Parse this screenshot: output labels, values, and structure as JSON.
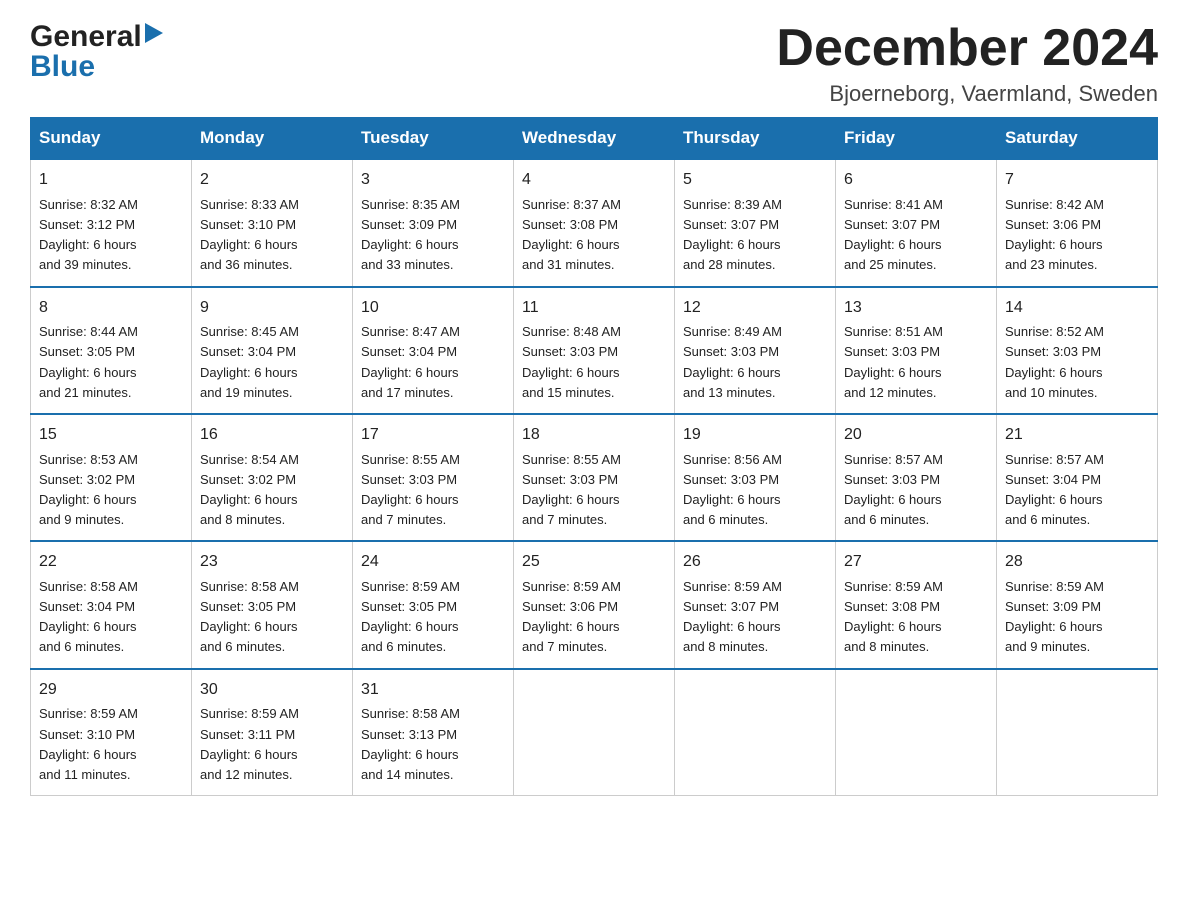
{
  "logo": {
    "general": "General",
    "blue": "Blue",
    "arrow_color": "#1a6fad"
  },
  "header": {
    "month_title": "December 2024",
    "location": "Bjoerneborg, Vaermland, Sweden"
  },
  "weekdays": [
    "Sunday",
    "Monday",
    "Tuesday",
    "Wednesday",
    "Thursday",
    "Friday",
    "Saturday"
  ],
  "weeks": [
    [
      {
        "day": "1",
        "sunrise": "Sunrise: 8:32 AM",
        "sunset": "Sunset: 3:12 PM",
        "daylight": "Daylight: 6 hours",
        "minutes": "and 39 minutes."
      },
      {
        "day": "2",
        "sunrise": "Sunrise: 8:33 AM",
        "sunset": "Sunset: 3:10 PM",
        "daylight": "Daylight: 6 hours",
        "minutes": "and 36 minutes."
      },
      {
        "day": "3",
        "sunrise": "Sunrise: 8:35 AM",
        "sunset": "Sunset: 3:09 PM",
        "daylight": "Daylight: 6 hours",
        "minutes": "and 33 minutes."
      },
      {
        "day": "4",
        "sunrise": "Sunrise: 8:37 AM",
        "sunset": "Sunset: 3:08 PM",
        "daylight": "Daylight: 6 hours",
        "minutes": "and 31 minutes."
      },
      {
        "day": "5",
        "sunrise": "Sunrise: 8:39 AM",
        "sunset": "Sunset: 3:07 PM",
        "daylight": "Daylight: 6 hours",
        "minutes": "and 28 minutes."
      },
      {
        "day": "6",
        "sunrise": "Sunrise: 8:41 AM",
        "sunset": "Sunset: 3:07 PM",
        "daylight": "Daylight: 6 hours",
        "minutes": "and 25 minutes."
      },
      {
        "day": "7",
        "sunrise": "Sunrise: 8:42 AM",
        "sunset": "Sunset: 3:06 PM",
        "daylight": "Daylight: 6 hours",
        "minutes": "and 23 minutes."
      }
    ],
    [
      {
        "day": "8",
        "sunrise": "Sunrise: 8:44 AM",
        "sunset": "Sunset: 3:05 PM",
        "daylight": "Daylight: 6 hours",
        "minutes": "and 21 minutes."
      },
      {
        "day": "9",
        "sunrise": "Sunrise: 8:45 AM",
        "sunset": "Sunset: 3:04 PM",
        "daylight": "Daylight: 6 hours",
        "minutes": "and 19 minutes."
      },
      {
        "day": "10",
        "sunrise": "Sunrise: 8:47 AM",
        "sunset": "Sunset: 3:04 PM",
        "daylight": "Daylight: 6 hours",
        "minutes": "and 17 minutes."
      },
      {
        "day": "11",
        "sunrise": "Sunrise: 8:48 AM",
        "sunset": "Sunset: 3:03 PM",
        "daylight": "Daylight: 6 hours",
        "minutes": "and 15 minutes."
      },
      {
        "day": "12",
        "sunrise": "Sunrise: 8:49 AM",
        "sunset": "Sunset: 3:03 PM",
        "daylight": "Daylight: 6 hours",
        "minutes": "and 13 minutes."
      },
      {
        "day": "13",
        "sunrise": "Sunrise: 8:51 AM",
        "sunset": "Sunset: 3:03 PM",
        "daylight": "Daylight: 6 hours",
        "minutes": "and 12 minutes."
      },
      {
        "day": "14",
        "sunrise": "Sunrise: 8:52 AM",
        "sunset": "Sunset: 3:03 PM",
        "daylight": "Daylight: 6 hours",
        "minutes": "and 10 minutes."
      }
    ],
    [
      {
        "day": "15",
        "sunrise": "Sunrise: 8:53 AM",
        "sunset": "Sunset: 3:02 PM",
        "daylight": "Daylight: 6 hours",
        "minutes": "and 9 minutes."
      },
      {
        "day": "16",
        "sunrise": "Sunrise: 8:54 AM",
        "sunset": "Sunset: 3:02 PM",
        "daylight": "Daylight: 6 hours",
        "minutes": "and 8 minutes."
      },
      {
        "day": "17",
        "sunrise": "Sunrise: 8:55 AM",
        "sunset": "Sunset: 3:03 PM",
        "daylight": "Daylight: 6 hours",
        "minutes": "and 7 minutes."
      },
      {
        "day": "18",
        "sunrise": "Sunrise: 8:55 AM",
        "sunset": "Sunset: 3:03 PM",
        "daylight": "Daylight: 6 hours",
        "minutes": "and 7 minutes."
      },
      {
        "day": "19",
        "sunrise": "Sunrise: 8:56 AM",
        "sunset": "Sunset: 3:03 PM",
        "daylight": "Daylight: 6 hours",
        "minutes": "and 6 minutes."
      },
      {
        "day": "20",
        "sunrise": "Sunrise: 8:57 AM",
        "sunset": "Sunset: 3:03 PM",
        "daylight": "Daylight: 6 hours",
        "minutes": "and 6 minutes."
      },
      {
        "day": "21",
        "sunrise": "Sunrise: 8:57 AM",
        "sunset": "Sunset: 3:04 PM",
        "daylight": "Daylight: 6 hours",
        "minutes": "and 6 minutes."
      }
    ],
    [
      {
        "day": "22",
        "sunrise": "Sunrise: 8:58 AM",
        "sunset": "Sunset: 3:04 PM",
        "daylight": "Daylight: 6 hours",
        "minutes": "and 6 minutes."
      },
      {
        "day": "23",
        "sunrise": "Sunrise: 8:58 AM",
        "sunset": "Sunset: 3:05 PM",
        "daylight": "Daylight: 6 hours",
        "minutes": "and 6 minutes."
      },
      {
        "day": "24",
        "sunrise": "Sunrise: 8:59 AM",
        "sunset": "Sunset: 3:05 PM",
        "daylight": "Daylight: 6 hours",
        "minutes": "and 6 minutes."
      },
      {
        "day": "25",
        "sunrise": "Sunrise: 8:59 AM",
        "sunset": "Sunset: 3:06 PM",
        "daylight": "Daylight: 6 hours",
        "minutes": "and 7 minutes."
      },
      {
        "day": "26",
        "sunrise": "Sunrise: 8:59 AM",
        "sunset": "Sunset: 3:07 PM",
        "daylight": "Daylight: 6 hours",
        "minutes": "and 8 minutes."
      },
      {
        "day": "27",
        "sunrise": "Sunrise: 8:59 AM",
        "sunset": "Sunset: 3:08 PM",
        "daylight": "Daylight: 6 hours",
        "minutes": "and 8 minutes."
      },
      {
        "day": "28",
        "sunrise": "Sunrise: 8:59 AM",
        "sunset": "Sunset: 3:09 PM",
        "daylight": "Daylight: 6 hours",
        "minutes": "and 9 minutes."
      }
    ],
    [
      {
        "day": "29",
        "sunrise": "Sunrise: 8:59 AM",
        "sunset": "Sunset: 3:10 PM",
        "daylight": "Daylight: 6 hours",
        "minutes": "and 11 minutes."
      },
      {
        "day": "30",
        "sunrise": "Sunrise: 8:59 AM",
        "sunset": "Sunset: 3:11 PM",
        "daylight": "Daylight: 6 hours",
        "minutes": "and 12 minutes."
      },
      {
        "day": "31",
        "sunrise": "Sunrise: 8:58 AM",
        "sunset": "Sunset: 3:13 PM",
        "daylight": "Daylight: 6 hours",
        "minutes": "and 14 minutes."
      },
      null,
      null,
      null,
      null
    ]
  ]
}
